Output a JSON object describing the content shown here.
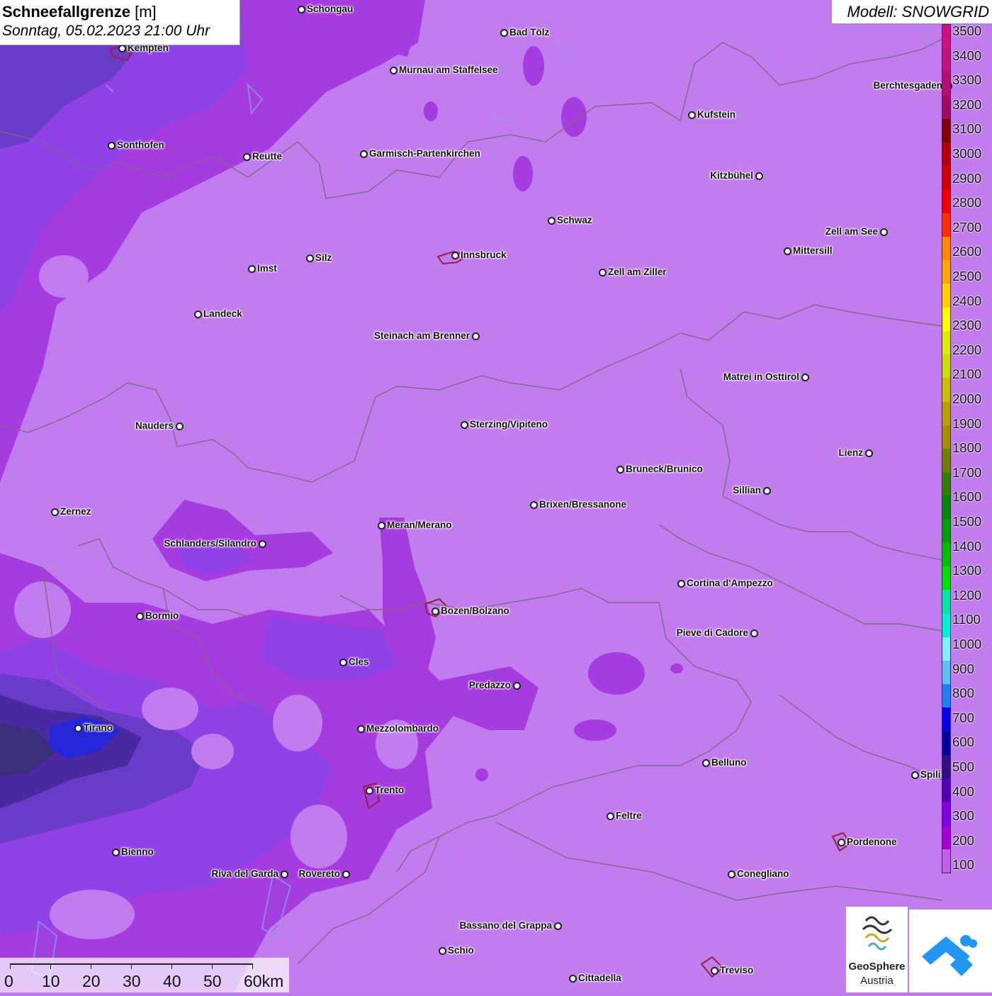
{
  "title": {
    "parameter": "Schneefallgrenze",
    "unit": "[m]",
    "datetime": "Sonntag, 05.02.2023 21:00 Uhr"
  },
  "model": "Modell: SNOWGRID",
  "legend": {
    "ticks": [
      "3500",
      "3400",
      "3300",
      "3200",
      "3100",
      "3000",
      "2900",
      "2800",
      "2700",
      "2600",
      "2500",
      "2400",
      "2300",
      "2200",
      "2100",
      "2000",
      "1900",
      "1800",
      "1700",
      "1600",
      "1500",
      "1400",
      "1300",
      "1200",
      "1100",
      "1000",
      "900",
      "800",
      "700",
      "600",
      "500",
      "400",
      "300",
      "200",
      "100"
    ],
    "colors": [
      "#cc1480",
      "#c01478",
      "#b01070",
      "#a00a60",
      "#800000",
      "#b00000",
      "#d00000",
      "#f00000",
      "#ff3000",
      "#ff8a00",
      "#ffaa00",
      "#ffd000",
      "#ffff00",
      "#d8f000",
      "#c8e000",
      "#c8c000",
      "#b8a000",
      "#a09000",
      "#708000",
      "#308000",
      "#008800",
      "#00a000",
      "#00c000",
      "#00e000",
      "#00e8a0",
      "#00f0d0",
      "#80f0ff",
      "#60c0f0",
      "#2080f0",
      "#0000e0",
      "#0000a0",
      "#301080",
      "#5000b0",
      "#8000e0",
      "#a000d0",
      "#c060e8"
    ]
  },
  "cities": [
    {
      "name": "Schongau",
      "side": "r"
    },
    {
      "name": "Bad Tölz",
      "side": "r"
    },
    {
      "name": "Kempten",
      "side": "r"
    },
    {
      "name": "Murnau am Staffelsee",
      "side": "r"
    },
    {
      "name": "Berchtesgaden",
      "side": "l"
    },
    {
      "name": "Kufstein",
      "side": "r"
    },
    {
      "name": "Sonthofen",
      "side": "r"
    },
    {
      "name": "Reutte",
      "side": "r"
    },
    {
      "name": "Garmisch-Partenkirchen",
      "side": "r"
    },
    {
      "name": "Kitzbühel",
      "side": "l"
    },
    {
      "name": "Schwaz",
      "side": "r"
    },
    {
      "name": "Zell am See",
      "side": "l"
    },
    {
      "name": "Mittersill",
      "side": "r"
    },
    {
      "name": "Innsbruck",
      "side": "r"
    },
    {
      "name": "Silz",
      "side": "r"
    },
    {
      "name": "Imst",
      "side": "r"
    },
    {
      "name": "Zell am Ziller",
      "side": "r"
    },
    {
      "name": "Landeck",
      "side": "r"
    },
    {
      "name": "Steinach am Brenner",
      "side": "l"
    },
    {
      "name": "Matrei in Osttirol",
      "side": "l"
    },
    {
      "name": "Nauders",
      "side": "l"
    },
    {
      "name": "Sterzing/Vipiteno",
      "side": "r"
    },
    {
      "name": "Lienz",
      "side": "l"
    },
    {
      "name": "Bruneck/Brunico",
      "side": "r"
    },
    {
      "name": "Sillian",
      "side": "l"
    },
    {
      "name": "Zernez",
      "side": "r"
    },
    {
      "name": "Brixen/Bressanone",
      "side": "r"
    },
    {
      "name": "Meran/Merano",
      "side": "r"
    },
    {
      "name": "Schlanders/Silandro",
      "side": "l"
    },
    {
      "name": "Cortina d'Ampezzo",
      "side": "r"
    },
    {
      "name": "Bozen/Bolzano",
      "side": "r"
    },
    {
      "name": "Bormio",
      "side": "r"
    },
    {
      "name": "Pieve di Cadore",
      "side": "l"
    },
    {
      "name": "Cles",
      "side": "r"
    },
    {
      "name": "Predazzo",
      "side": "l"
    },
    {
      "name": "Tirano",
      "side": "r"
    },
    {
      "name": "Mezzolombardo",
      "side": "r"
    },
    {
      "name": "Belluno",
      "side": "r"
    },
    {
      "name": "Spili",
      "side": "r"
    },
    {
      "name": "Trento",
      "side": "r"
    },
    {
      "name": "Feltre",
      "side": "r"
    },
    {
      "name": "Pordenone",
      "side": "r"
    },
    {
      "name": "Bienno",
      "side": "r"
    },
    {
      "name": "Riva del Garda",
      "side": "l"
    },
    {
      "name": "Rovereto",
      "side": "l"
    },
    {
      "name": "Conegliano",
      "side": "r"
    },
    {
      "name": "Bassano del Grappa",
      "side": "l"
    },
    {
      "name": "Schio",
      "side": "r"
    },
    {
      "name": "Treviso",
      "side": "r"
    },
    {
      "name": "Cittadella",
      "side": "r"
    }
  ],
  "scale": {
    "labels": [
      "0",
      "10",
      "20",
      "30",
      "40",
      "50",
      "60km"
    ]
  },
  "logos": {
    "geosphere_line1": "GeoSphere",
    "geosphere_line2": "Austria"
  }
}
